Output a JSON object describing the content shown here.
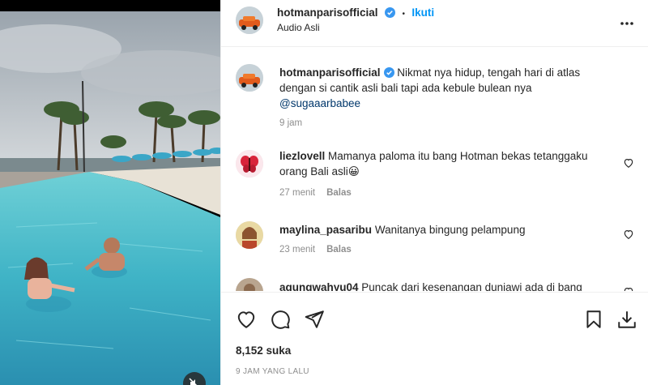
{
  "post": {
    "author": "hotmanparisofficial",
    "follow_label": "Ikuti",
    "separator": "•",
    "audio": "Audio Asli",
    "more_label": "•••"
  },
  "caption": {
    "author": "hotmanparisofficial",
    "text": "Nikmat nya hidup, tengah hari di atlas dengan si cantik asli bali tapi ada kebule bulean nya",
    "mention": "@sugaaarbabee",
    "time": "9 jam"
  },
  "comments": [
    {
      "user": "liezlovell",
      "text": "Mamanya paloma itu bang Hotman bekas tetanggaku orang Bali asli😀",
      "time": "27 menit",
      "reply": "Balas"
    },
    {
      "user": "maylina_pasaribu",
      "text": "Wanitanya bingung pelampung",
      "time": "23 menit",
      "reply": "Balas"
    },
    {
      "user": "agungwahyu04",
      "text": "Puncak dari kesenangan duniawi ada di bang"
    }
  ],
  "stats": {
    "likes": "8,152 suka",
    "posted": "9 JAM YANG LALU"
  },
  "colors": {
    "accent": "#0095f6",
    "verified": "#3897f0",
    "muted": "#8e8e8e",
    "pool": "#5fc3cf"
  },
  "icons": [
    "heart-icon",
    "comment-icon",
    "share-icon",
    "bookmark-icon",
    "download-icon",
    "verified-badge-icon",
    "mute-icon",
    "more-icon"
  ]
}
